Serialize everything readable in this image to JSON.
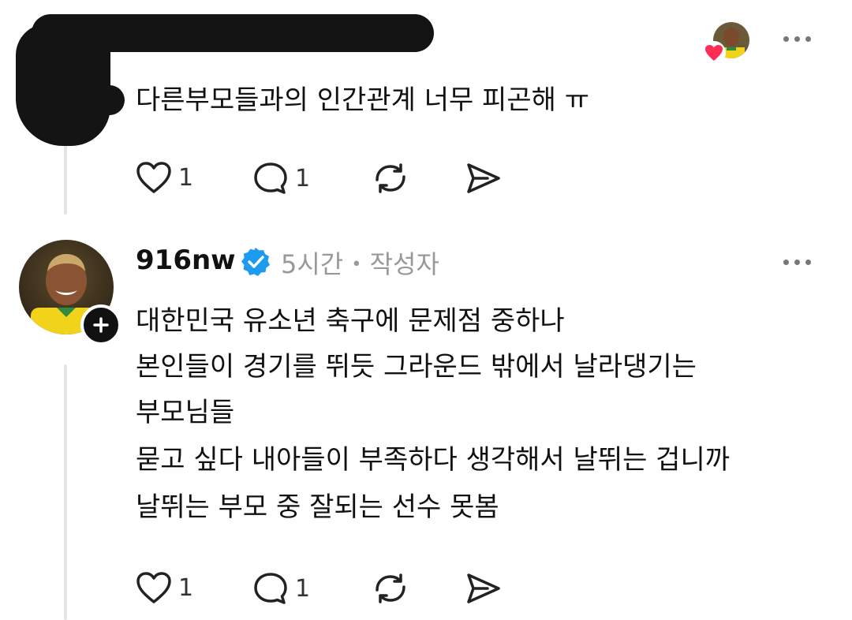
{
  "first_post": {
    "text": "다른부모들과의 인간관계 너무 피곤해 ㅠ",
    "like_count": "1",
    "reply_count": "1"
  },
  "second_post": {
    "username": "916nw",
    "time": "5시간",
    "separator": "•",
    "author_label": "작성자",
    "lines": [
      "대한민국 유소년 축구에 문제점 중하나",
      "본인들이 경기를 뛰듯 그라운드 밖에서 날라댕기는",
      "부모님들",
      "묻고 싶다 내아들이 부족하다 생각해서 날뛰는 겁니까",
      "날뛰는 부모 중 잘되는 선수 못봄"
    ],
    "like_count": "1",
    "reply_count": "1"
  },
  "colors": {
    "verified": "#1d9bf0",
    "meta_gray": "#999999",
    "heart_badge": "#ff2d55",
    "jersey_yellow": "#f2d31b"
  }
}
